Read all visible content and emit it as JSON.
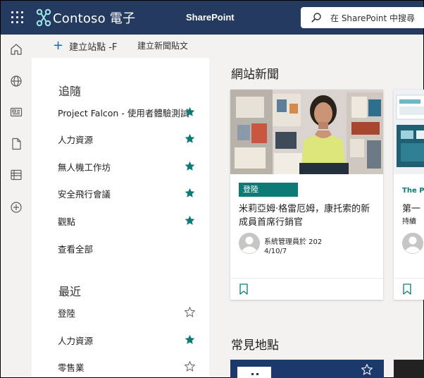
{
  "topbar": {
    "brand": "Contoso 電子",
    "app_name": "SharePoint",
    "search_placeholder": "在 SharePoint 中搜尋",
    "bg_color": "#243a5e"
  },
  "rail": {
    "items": [
      "home-icon",
      "globe-icon",
      "news-icon",
      "document-icon",
      "list-icon",
      "add-icon"
    ]
  },
  "commandbar": {
    "create_site_label": "建立站點 -F",
    "create_news_label": "建立新聞貼文"
  },
  "following": {
    "title": "追隨",
    "items": [
      {
        "label": "Project Falcon - 使用者體驗測試",
        "starred": true
      },
      {
        "label": "人力資源",
        "starred": true
      },
      {
        "label": "無人機工作坊",
        "starred": true
      },
      {
        "label": "安全飛行會議",
        "starred": true
      },
      {
        "label": "觀點",
        "starred": true
      }
    ],
    "see_all": "查看全部"
  },
  "recent": {
    "title": "最近",
    "items": [
      {
        "label": "登陸",
        "starred": false
      },
      {
        "label": "人力資源",
        "starred": true
      },
      {
        "label": "零售業",
        "starred": false
      }
    ]
  },
  "news": {
    "heading": "網站新聞",
    "cards": [
      {
        "badge": "登陸",
        "title": "米莉亞姆·格雷厄姆，康托索的新成員首席行銷官",
        "author": "系統管理員於 202",
        "date": "4/10/7"
      },
      {
        "label": "The Pe",
        "title": "第一",
        "subtitle": "持續"
      }
    ]
  },
  "frequent": {
    "heading": "常見地點"
  },
  "colors": {
    "accent": "#0e7a75",
    "star": "#0e7a75",
    "brand_blue": "#0f6cbd"
  }
}
